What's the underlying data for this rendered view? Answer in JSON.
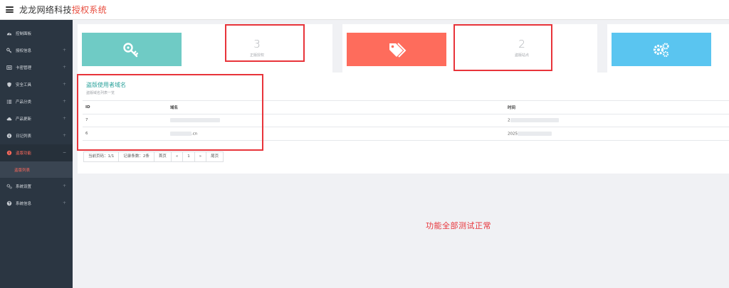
{
  "header": {
    "brand_main": "龙龙网络科技",
    "brand_accent": "授权系统"
  },
  "sidebar": {
    "items": [
      {
        "label": "控制面板",
        "icon": "dashboard-icon"
      },
      {
        "label": "授权信息",
        "icon": "key-icon"
      },
      {
        "label": "卡密管理",
        "icon": "card-icon"
      },
      {
        "label": "安全工具",
        "icon": "shield-icon"
      },
      {
        "label": "产品分类",
        "icon": "list-icon"
      },
      {
        "label": "产品更新",
        "icon": "cloud-icon"
      },
      {
        "label": "日记列表",
        "icon": "info-icon"
      },
      {
        "label": "盗版功能",
        "icon": "warning-icon"
      },
      {
        "label": "系统设置",
        "icon": "gears-icon"
      },
      {
        "label": "系统信息",
        "icon": "help-icon"
      }
    ],
    "plus": "+",
    "minus": "−",
    "active_sub": "盗版列表"
  },
  "stats": [
    {
      "value": "3",
      "caption": "正版授权",
      "color": "#6fcbc5",
      "icon": "key-icon"
    },
    {
      "value": "2",
      "caption": "盗版站点",
      "color": "#fe6c5c",
      "icon": "tags-icon"
    },
    {
      "value": "",
      "caption": "",
      "color": "#5ac5f0",
      "icon": "gears-icon"
    }
  ],
  "panel": {
    "title": "盗版使用者域名",
    "subtitle": "盗版域名列表一览",
    "columns": [
      "ID",
      "域名",
      "时间"
    ],
    "rows": [
      {
        "id": "7",
        "domain": "",
        "time": "2"
      },
      {
        "id": "6",
        "domain": ".cn",
        "time": "2025"
      }
    ]
  },
  "pager": {
    "current": "当前页码：1/1",
    "records": "记录条数：2条",
    "first": "首页",
    "prev": "«",
    "page": "1",
    "next": "»",
    "last": "尾页"
  },
  "note": "功能全部测试正常",
  "colors": {
    "sidebar_bg": "#2b3642",
    "accent_red": "#e8343a",
    "teal": "#2aa29b"
  }
}
